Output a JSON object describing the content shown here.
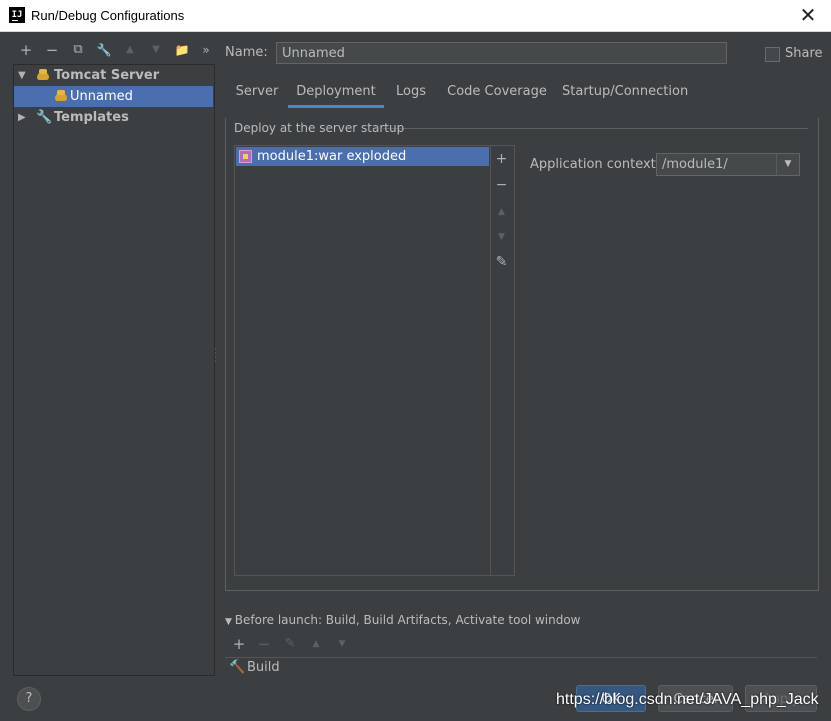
{
  "window": {
    "title": "Run/Debug Configurations",
    "close_glyph": "✕"
  },
  "left_toolbar": {
    "add": "+",
    "remove": "−",
    "copy": "⧉",
    "edit_defaults": "🔧",
    "move_up": "▲",
    "move_down": "▼",
    "new_folder": "📁",
    "more": "»"
  },
  "tree": {
    "items": [
      {
        "label": "Tomcat Server"
      },
      {
        "label": "Unnamed"
      },
      {
        "label": "Templates"
      }
    ]
  },
  "name_field": {
    "label": "Name:",
    "value": "Unnamed"
  },
  "share": {
    "label": "Share"
  },
  "tabs": [
    {
      "label": "Server"
    },
    {
      "label": "Deployment"
    },
    {
      "label": "Logs"
    },
    {
      "label": "Code Coverage"
    },
    {
      "label": "Startup/Connection"
    }
  ],
  "deployment": {
    "group_title": "Deploy at the server startup",
    "artifacts": [
      {
        "label": "module1:war exploded"
      }
    ],
    "tools": {
      "add": "+",
      "remove": "−",
      "up": "▲",
      "down": "▼",
      "edit": "✎"
    },
    "app_context": {
      "label": "Application context:",
      "value": "/module1/"
    }
  },
  "before_launch": {
    "title": "Before launch: Build, Build Artifacts, Activate tool window",
    "items": [
      {
        "label": "Build"
      }
    ]
  },
  "footer": {
    "help": "?",
    "ok": "OK",
    "cancel": "Cancel",
    "apply": "Apply",
    "watermark": "https://blog.csdn.net/JAVA_php_Jack"
  }
}
